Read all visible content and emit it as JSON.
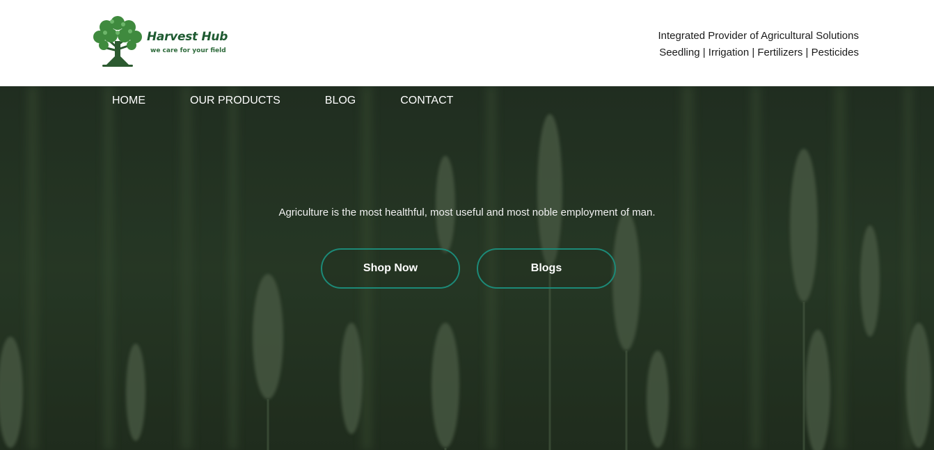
{
  "brand": {
    "name": "Harvest Hub",
    "tagline": "we care for your field",
    "logo_icon": "tree-icon",
    "color": "#1e5a31"
  },
  "header": {
    "line1": "Integrated Provider of Agricultural Solutions",
    "line2": "Seedling | Irrigation | Fertilizers | Pesticides"
  },
  "nav": {
    "items": [
      {
        "label": "HOME"
      },
      {
        "label": "OUR PRODUCTS"
      },
      {
        "label": "BLOG"
      },
      {
        "label": "CONTACT"
      }
    ]
  },
  "hero": {
    "quote": "Agriculture is the most healthful, most useful and most noble employment of man.",
    "background": "wheat-field-image",
    "buttons": {
      "shop": "Shop Now",
      "blogs": "Blogs"
    },
    "accent": "#1c8a78"
  }
}
